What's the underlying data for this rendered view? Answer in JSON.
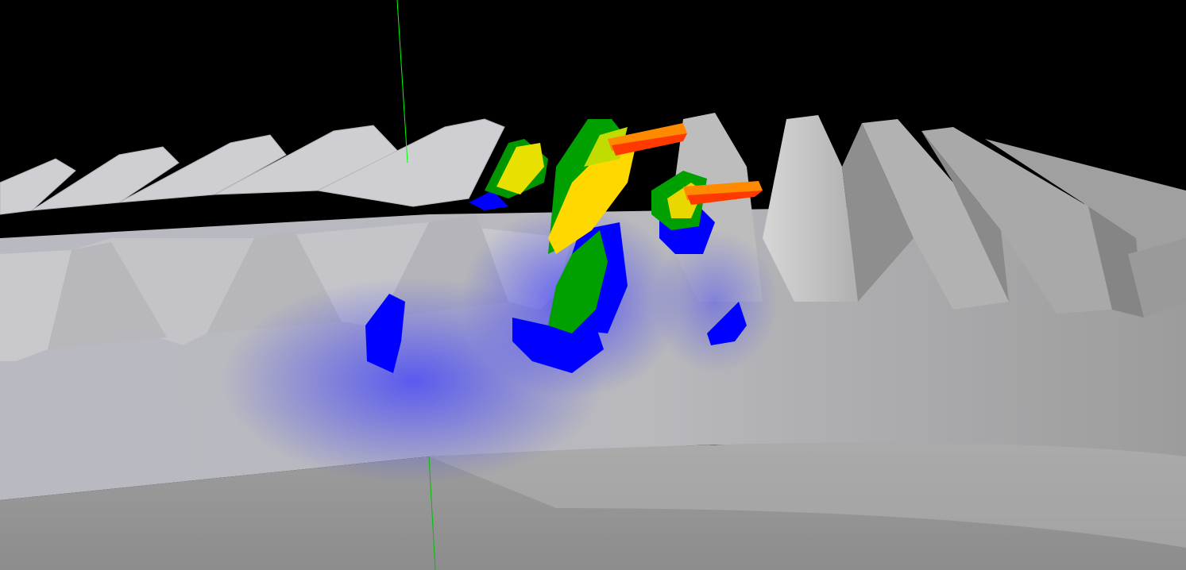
{
  "viewport": {
    "background_color": "#000000",
    "axis_line_color": "#00ff00"
  },
  "gear": {
    "surface_color": "#c8c8c8",
    "shadow_color": "#8a8a8a",
    "highlight_color": "#dedede"
  },
  "stress_colormap": [
    "#0000ff",
    "#00a000",
    "#b8d800",
    "#ffd800",
    "#ff5a00",
    "#ff2a00"
  ]
}
